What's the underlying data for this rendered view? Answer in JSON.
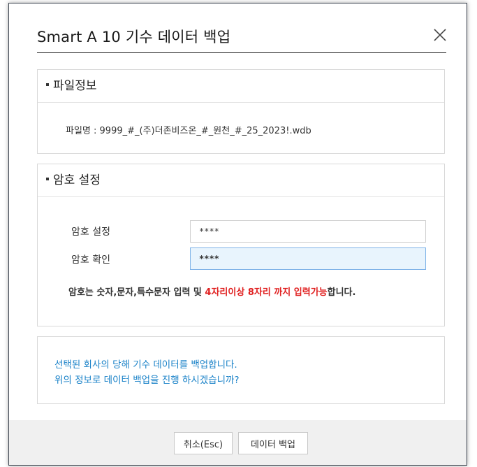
{
  "dialog": {
    "title": "Smart A 10 기수 데이터 백업"
  },
  "file_info": {
    "header": "파일정보",
    "file_line": "파일명 : 9999_#_(주)더존비즈온_#_원천_#_25_2023!.wdb"
  },
  "password": {
    "header": "암호 설정",
    "set_label": "암호 설정",
    "set_value": "****",
    "confirm_label": "암호 확인",
    "confirm_value": "****",
    "note_prefix": "암호는 숫자,문자,특수문자 입력 및 ",
    "note_highlight": "4자리이상 8자리 까지 입력가능",
    "note_suffix": "합니다."
  },
  "message": {
    "line1": "선택된 회사의 당해 기수 데이터를 백업합니다.",
    "line2": "위의 정보로 데이터 백업을 진행 하시겠습니까?"
  },
  "buttons": {
    "cancel": "취소(Esc)",
    "backup": "데이터 백업"
  },
  "colors": {
    "highlight": "#e02020",
    "message": "#1a82c8",
    "active_field": "#e8f4fd"
  }
}
